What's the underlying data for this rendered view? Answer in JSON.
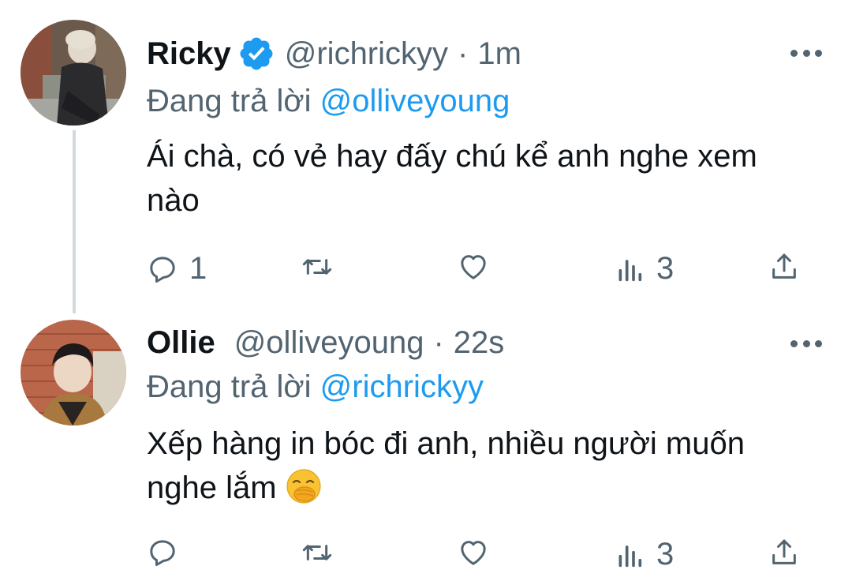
{
  "tweets": [
    {
      "name": "Ricky",
      "verified": true,
      "handle": "@richrickyy",
      "separator": "·",
      "time": "1m",
      "reply_prefix": "Đang trả lời",
      "reply_to": "@olliveyoung",
      "text": "Ái chà, có vẻ hay đấy chú kể anh nghe xem nào",
      "emoji": "",
      "reply_count": "1",
      "retweet_count": "",
      "like_count": "",
      "views_count": "3"
    },
    {
      "name": "Ollie",
      "verified": false,
      "handle": "@olliveyoung",
      "separator": "·",
      "time": "22s",
      "reply_prefix": "Đang trả lời",
      "reply_to": "@richrickyy",
      "text": "Xếp hàng in bóc đi anh, nhiều người muốn nghe lắm",
      "emoji": "face-with-hand-over-mouth",
      "reply_count": "",
      "retweet_count": "",
      "like_count": "",
      "views_count": "3"
    }
  ],
  "colors": {
    "link": "#1d9bf0",
    "secondary_text": "#536471",
    "thread_line": "#cfd9de",
    "verified_badge": "#1d9bf0"
  }
}
